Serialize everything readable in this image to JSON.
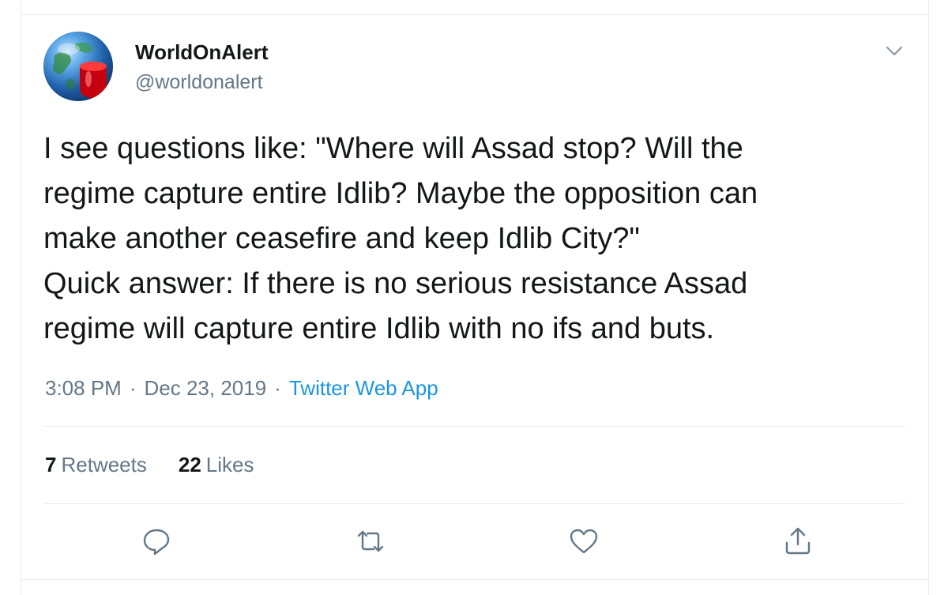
{
  "author": {
    "display_name": "WorldOnAlert",
    "handle": "@worldonalert"
  },
  "tweet": {
    "text": "I see questions like: \"Where will Assad stop? Will the\nregime capture entire Idlib? Maybe the opposition can\nmake another ceasefire and keep Idlib City?\"\nQuick answer: If there is no serious resistance Assad\nregime will capture entire Idlib with no ifs and buts.",
    "time": "3:08 PM",
    "separator": "·",
    "date": "Dec 23, 2019",
    "source": "Twitter Web App"
  },
  "stats": {
    "retweets_count": "7",
    "retweets_label": "Retweets",
    "likes_count": "22",
    "likes_label": "Likes"
  },
  "icons": {
    "menu": "chevron-down-icon",
    "reply": "reply-icon",
    "retweet": "retweet-icon",
    "like": "heart-icon",
    "share": "share-icon"
  },
  "colors": {
    "text_primary": "#14171a",
    "text_secondary": "#657786",
    "link": "#1b95e0",
    "border": "#e6ecf0"
  }
}
